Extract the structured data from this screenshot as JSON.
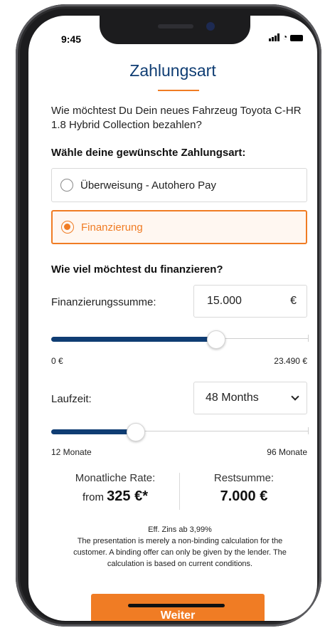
{
  "status_bar": {
    "time": "9:45"
  },
  "header": {
    "title": "Zahlungsart"
  },
  "question": "Wie möchtest Du Dein neues Fahrzeug Toyota C-HR 1.8 Hybrid Collection bezahlen?",
  "payment": {
    "label": "Wähle deine gewünschte Zahlungsart:",
    "options": [
      {
        "label": "Überweisung - Autohero Pay",
        "selected": false
      },
      {
        "label": "Finanzierung",
        "selected": true
      }
    ]
  },
  "financing": {
    "heading": "Wie viel möchtest du finanzieren?",
    "amount_label": "Finanzierungssumme:",
    "amount_value": "15.000",
    "currency": "€",
    "amount_slider": {
      "min_label": "0 €",
      "max_label": "23.490 €",
      "fraction": 0.64
    },
    "term_label": "Laufzeit:",
    "term_value": "48 Months",
    "term_slider": {
      "min_label": "12 Monate",
      "max_label": "96 Monate",
      "fraction": 0.33
    }
  },
  "summary": {
    "monthly_label": "Monatliche Rate:",
    "monthly_prefix": "from",
    "monthly_value": "325 €*",
    "rest_label": "Restsumme:",
    "rest_value": "7.000 €"
  },
  "disclaimer": {
    "rate": "Eff. Zins ab 3,99%",
    "text": "The presentation is merely a non-binding calculation for the customer. A binding offer can only be given by the lender. The calculation is based on current conditions."
  },
  "cta_label": "Weiter",
  "colors": {
    "accent": "#f07c24",
    "primary": "#0f3d73"
  }
}
